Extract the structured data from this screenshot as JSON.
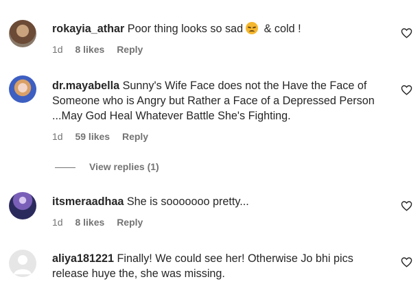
{
  "comments": [
    {
      "username": "rokayia_athar",
      "text": "Poor thing looks so sad",
      "emoji": "disappointed-face-emoji",
      "text_after": " & cold !",
      "time": "1d",
      "likes": "8 likes",
      "reply": "Reply"
    },
    {
      "username": "dr.mayabella",
      "text": "Sunny's Wife Face does not the Have the Face of Someone who is Angry but Rather a Face of a Depressed Person ...May God Heal Whatever Battle She's Fighting.",
      "time": "1d",
      "likes": "59 likes",
      "reply": "Reply",
      "view_replies": "View replies (1)"
    },
    {
      "username": "itsmeraadhaa",
      "text": "She is sooooooo pretty...",
      "time": "1d",
      "likes": "8 likes",
      "reply": "Reply"
    },
    {
      "username": "aliya181221",
      "text": "Finally! We could see her! Otherwise Jo bhi pics release huye the, she was missing."
    }
  ],
  "icons": {
    "like": "heart-outline-icon",
    "avatar_default": "default-avatar-icon"
  },
  "colors": {
    "text": "#262626",
    "muted": "#737373"
  }
}
